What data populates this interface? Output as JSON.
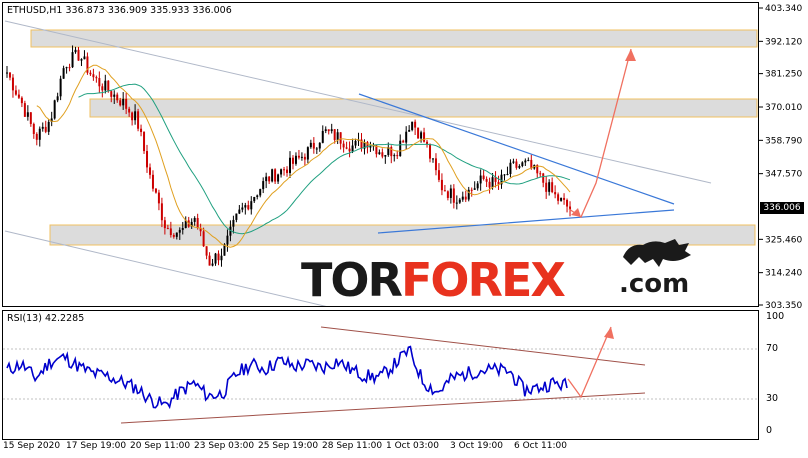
{
  "chart_header": {
    "symbol": "ETHUSD,H1",
    "open": "336.873",
    "high": "336.909",
    "low": "335.933",
    "close": "336.006"
  },
  "rsi_header": {
    "label": "RSI(13) 42.2285"
  },
  "watermark": {
    "part1": "TOR",
    "part2": "FOREX",
    "part3": ".com",
    "icon": "bull-icon"
  },
  "price_axis": {
    "labels": [
      "403.340",
      "392.120",
      "381.250",
      "370.010",
      "358.790",
      "347.570",
      "336.006",
      "325.460",
      "314.240",
      "303.350"
    ],
    "current_price": "336.006"
  },
  "rsi_axis": {
    "labels": [
      "100",
      "70",
      "30",
      "0"
    ]
  },
  "time_axis": {
    "labels": [
      "15 Sep 2020",
      "17 Sep 19:00",
      "20 Sep 11:00",
      "23 Sep 03:00",
      "25 Sep 19:00",
      "28 Sep 11:00",
      "1 Oct 03:00",
      "3 Oct 19:00",
      "6 Oct 11:00"
    ]
  },
  "colors": {
    "bull_candle": "#000000",
    "bear_candle": "#cc0000",
    "ma_fast": "#e0a020",
    "ma_slow": "#20a080",
    "trend_line": "#3a78d8",
    "channel_line": "#b0b8c8",
    "rsi_line": "#0000cc",
    "rsi_trend": "#a05048",
    "projection_arrow": "#f07060",
    "zone_fill": "#dcdcdc",
    "zone_border": "#f0c060"
  },
  "chart_data": {
    "type": "line",
    "series": [
      {
        "values": [
          382,
          372,
          360,
          366,
          385,
          388,
          380,
          376,
          372,
          366,
          345,
          330,
          328,
          333,
          318,
          322,
          334,
          340,
          346,
          349,
          352,
          356,
          362,
          360,
          357,
          359,
          355,
          356,
          366,
          358,
          344,
          340,
          342,
          346,
          344,
          350,
          351,
          346,
          340,
          336
        ]
      },
      {
        "values": [
          55,
          60,
          48,
          62,
          66,
          58,
          52,
          50,
          45,
          40,
          30,
          25,
          36,
          44,
          33,
          35,
          52,
          60,
          56,
          63,
          58,
          60,
          57,
          63,
          55,
          50,
          49,
          60,
          72,
          45,
          36,
          48,
          52,
          55,
          55,
          54,
          38,
          40,
          44,
          42
        ]
      }
    ]
  }
}
